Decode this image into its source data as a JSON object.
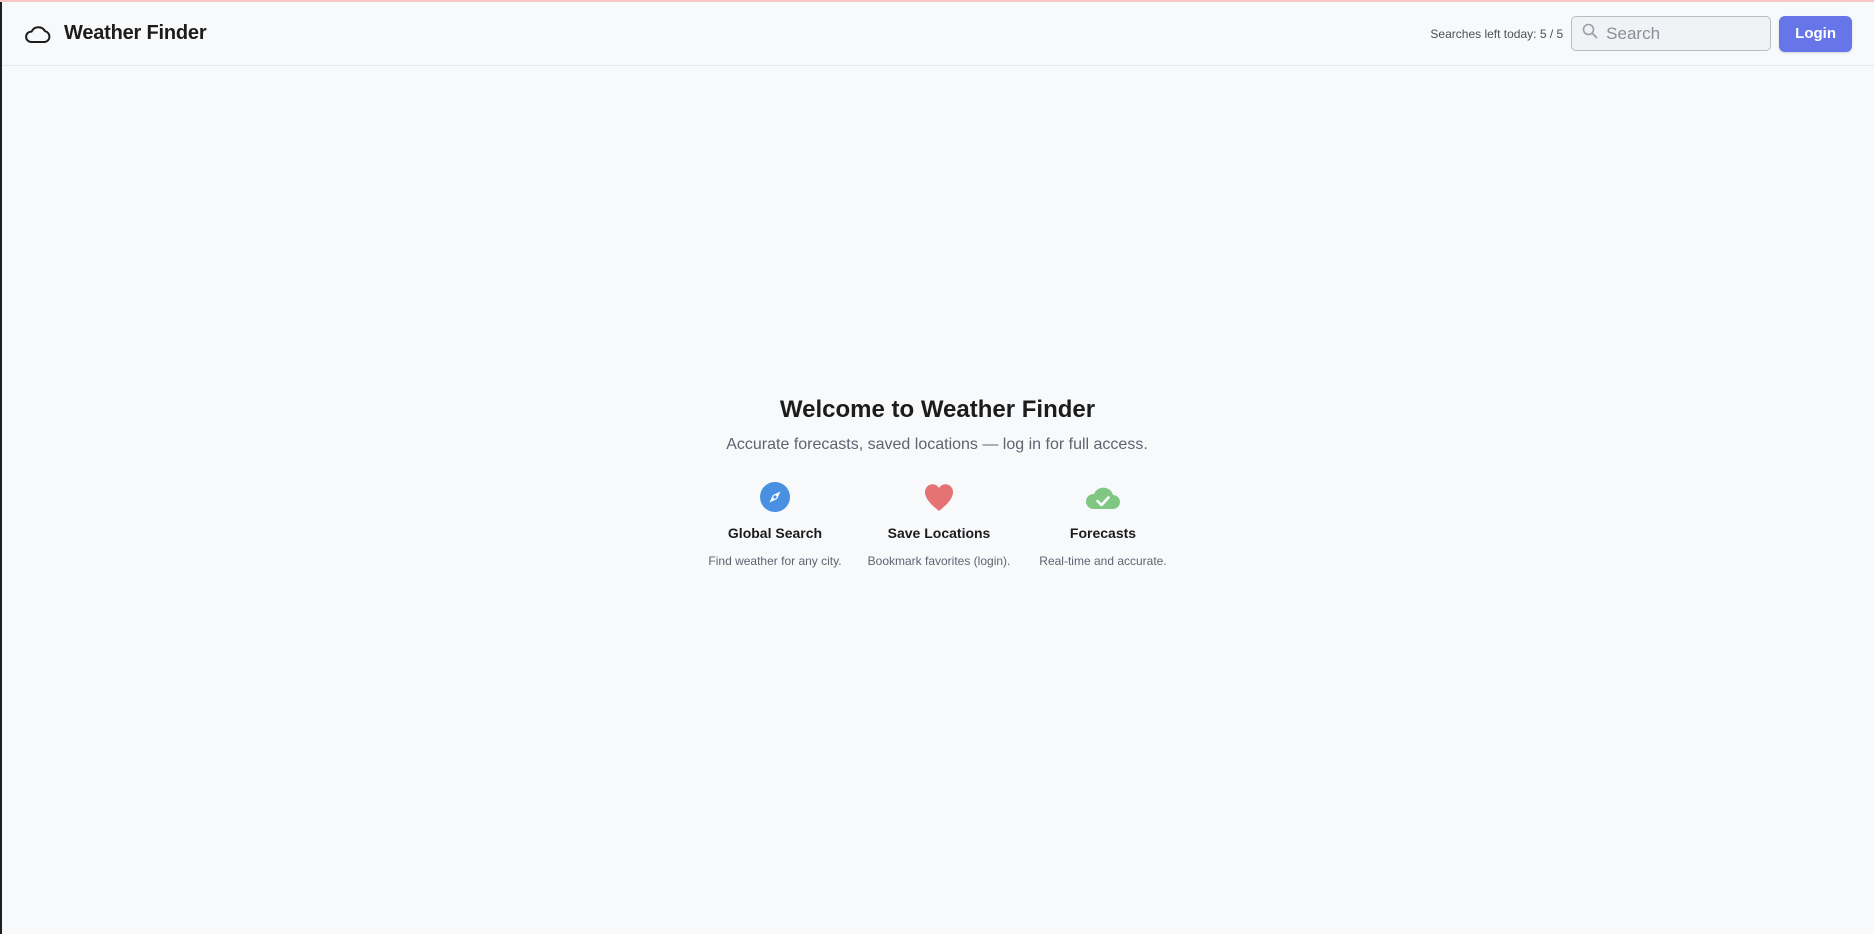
{
  "header": {
    "brand_icon": "cloud-icon",
    "brand_name": "Weather Finder",
    "searches_label": "Searches left today: 5 / 5",
    "search_placeholder": "Search",
    "search_value": "",
    "login_label": "Login"
  },
  "hero": {
    "title": "Welcome to Weather Finder",
    "subtitle": "Accurate forecasts, saved locations — log in for full access."
  },
  "features": [
    {
      "icon": "compass-icon",
      "color": "#4a90e2",
      "title": "Global Search",
      "description": "Find weather for any city."
    },
    {
      "icon": "heart-icon",
      "color": "#e57373",
      "title": "Save Locations",
      "description": "Bookmark favorites (login)."
    },
    {
      "icon": "cloud-check-icon",
      "color": "#81c784",
      "title": "Forecasts",
      "description": "Real-time and accurate."
    }
  ],
  "colors": {
    "accent": "#6675e8",
    "background": "#f8f9fb"
  }
}
